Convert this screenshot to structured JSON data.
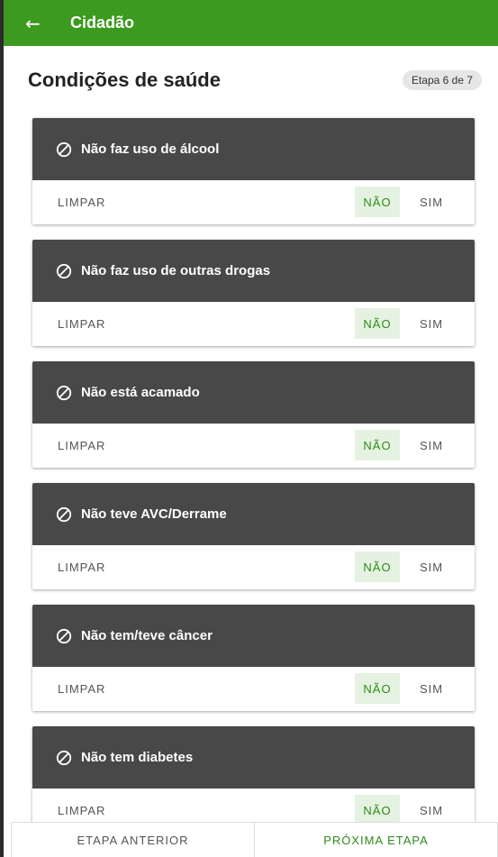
{
  "appbar": {
    "back_icon": "arrow-left-icon",
    "title": "Cidadão",
    "color": "#3c9a1e"
  },
  "header": {
    "title": "Condições de saúde",
    "step": "Etapa 6 de 7"
  },
  "conditions": [
    {
      "label": "Não faz uso de álcool",
      "clear": "LIMPAR",
      "no": "NÃO",
      "yes": "SIM",
      "icon": "block-icon"
    },
    {
      "label": "Não faz uso de outras drogas",
      "clear": "LIMPAR",
      "no": "NÃO",
      "yes": "SIM",
      "icon": "block-icon"
    },
    {
      "label": "Não está acamado",
      "clear": "LIMPAR",
      "no": "NÃO",
      "yes": "SIM",
      "icon": "block-icon"
    },
    {
      "label": "Não teve AVC/Derrame",
      "clear": "LIMPAR",
      "no": "NÃO",
      "yes": "SIM",
      "icon": "block-icon"
    },
    {
      "label": "Não tem/teve câncer",
      "clear": "LIMPAR",
      "no": "NÃO",
      "yes": "SIM",
      "icon": "block-icon"
    },
    {
      "label": "Não tem diabetes",
      "clear": "LIMPAR",
      "no": "NÃO",
      "yes": "SIM",
      "icon": "block-icon"
    }
  ],
  "footer": {
    "prev": "ETAPA ANTERIOR",
    "next": "PRÓXIMA ETAPA"
  }
}
